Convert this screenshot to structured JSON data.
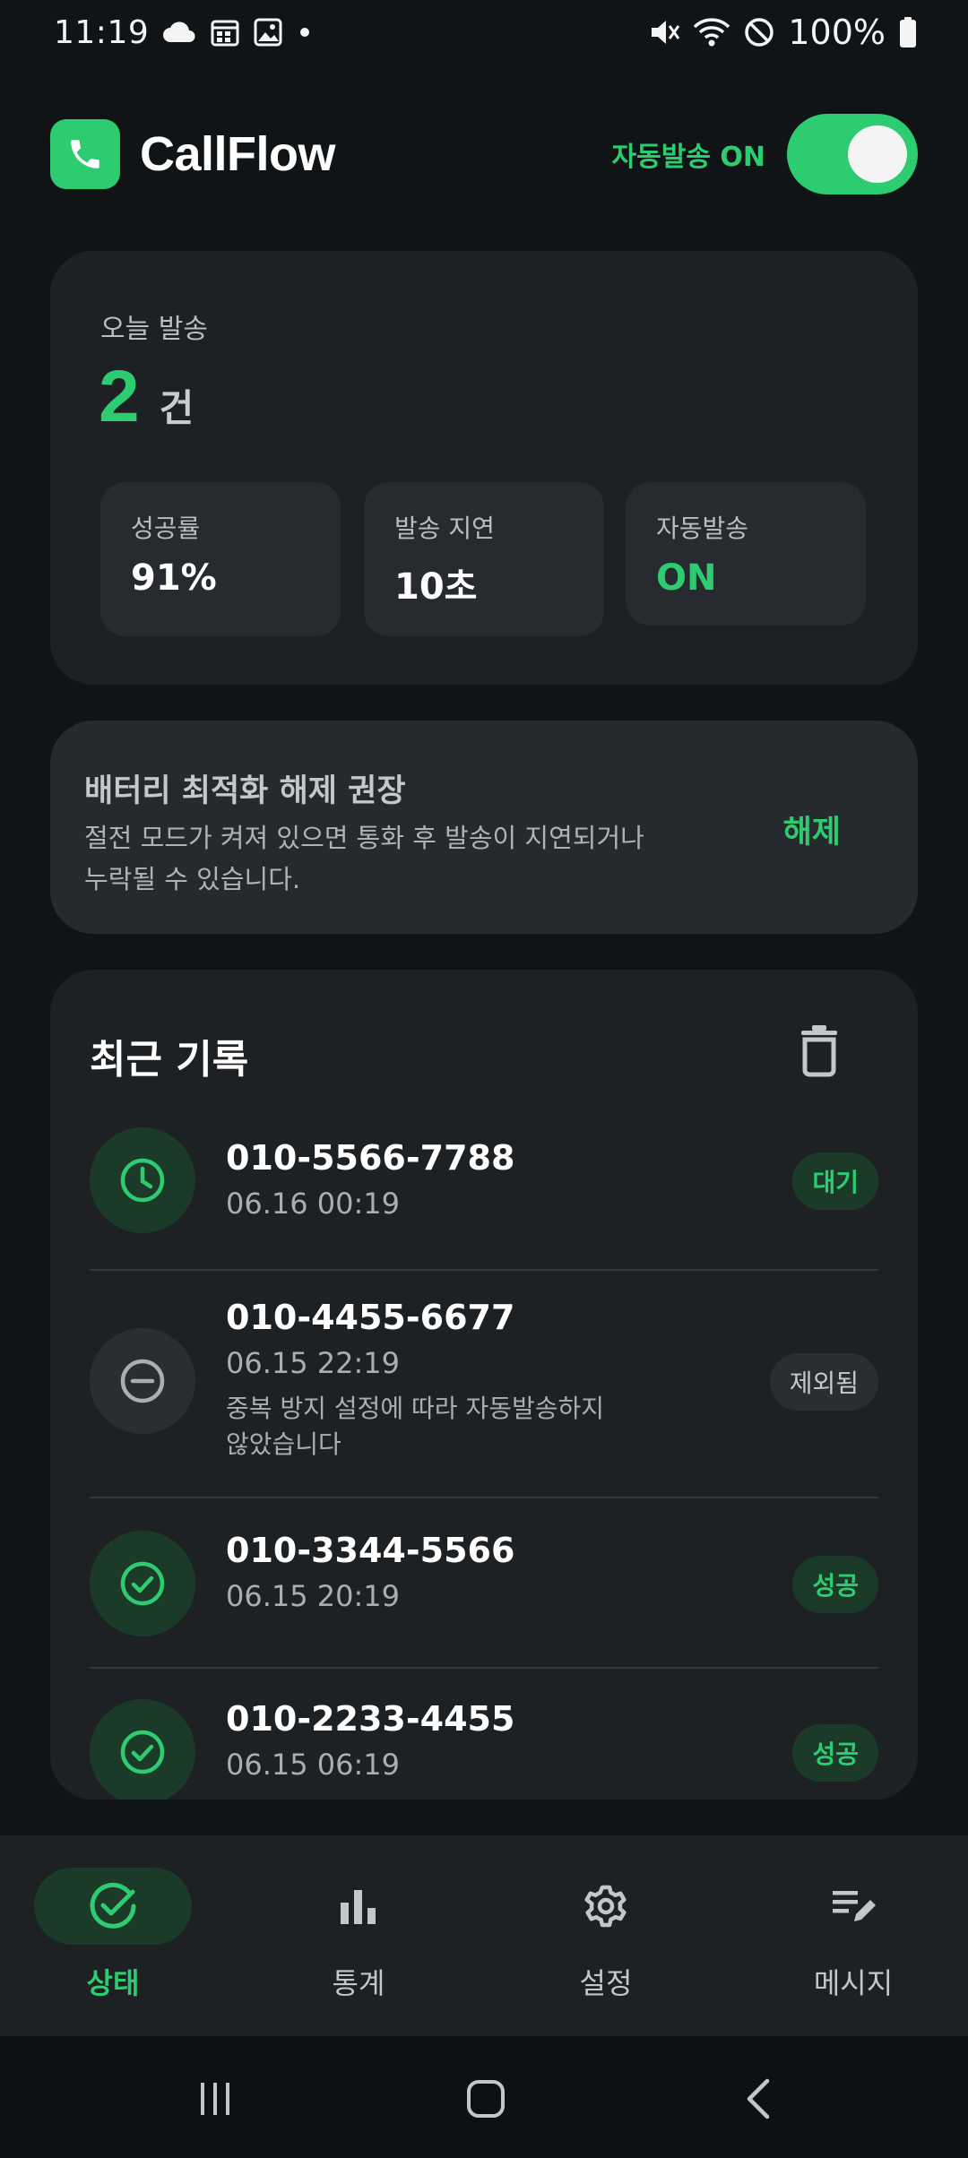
{
  "status_bar": {
    "time": "11:19",
    "battery_text": "100%",
    "left_icons": [
      "cloud-icon",
      "calendar-icon",
      "image-icon",
      "dot-icon"
    ],
    "right_icons": [
      "mute-icon",
      "wifi-icon",
      "do-not-disturb-icon",
      "battery-icon"
    ]
  },
  "header": {
    "app_name": "CallFlow",
    "auto_send_label": "자동발송 ON",
    "auto_send_on": true,
    "logo_icon": "phone-icon"
  },
  "today": {
    "label": "오늘 발송",
    "count": "2",
    "unit": "건",
    "stats": [
      {
        "title": "성공률",
        "value": "91%"
      },
      {
        "title": "발송 지연",
        "value": "10초"
      },
      {
        "title": "자동발송",
        "value": "ON"
      }
    ]
  },
  "battery_notice": {
    "title": "배터리 최적화 해제 권장",
    "line1": "절전 모드가 켜져 있으면 통화 후 발송이 지연되거나",
    "line2": "누락될 수 있습니다.",
    "action": "해제"
  },
  "recent": {
    "title": "최근 기록",
    "clear_icon": "trash-icon",
    "records": [
      {
        "phone": "010-5566-7788",
        "time": "06.16 00:19",
        "status": "대기",
        "icon": "clock-icon"
      },
      {
        "phone": "010-4455-6677",
        "time": "06.15 22:19",
        "note_line1": "중복 방지 설정에 따라 자동발송하지",
        "note_line2": "않았습니다",
        "status": "제외됨",
        "icon": "minus-circle-icon"
      },
      {
        "phone": "010-3344-5566",
        "time": "06.15 20:19",
        "status": "성공",
        "icon": "check-circle-icon"
      },
      {
        "phone": "010-2233-4455",
        "time": "06.15 06:19",
        "status": "성공",
        "icon": "check-circle-icon"
      }
    ]
  },
  "bottom_nav": {
    "items": [
      {
        "label": "상태",
        "icon": "check-circle-icon",
        "active": true
      },
      {
        "label": "통계",
        "icon": "bar-chart-icon",
        "active": false
      },
      {
        "label": "설정",
        "icon": "gear-icon",
        "active": false
      },
      {
        "label": "메시지",
        "icon": "edit-message-icon",
        "active": false
      }
    ]
  },
  "colors": {
    "accent": "#2ecc71",
    "background": "#111417",
    "card": "#1e2124",
    "badge_green_bg": "#1c3a28"
  }
}
